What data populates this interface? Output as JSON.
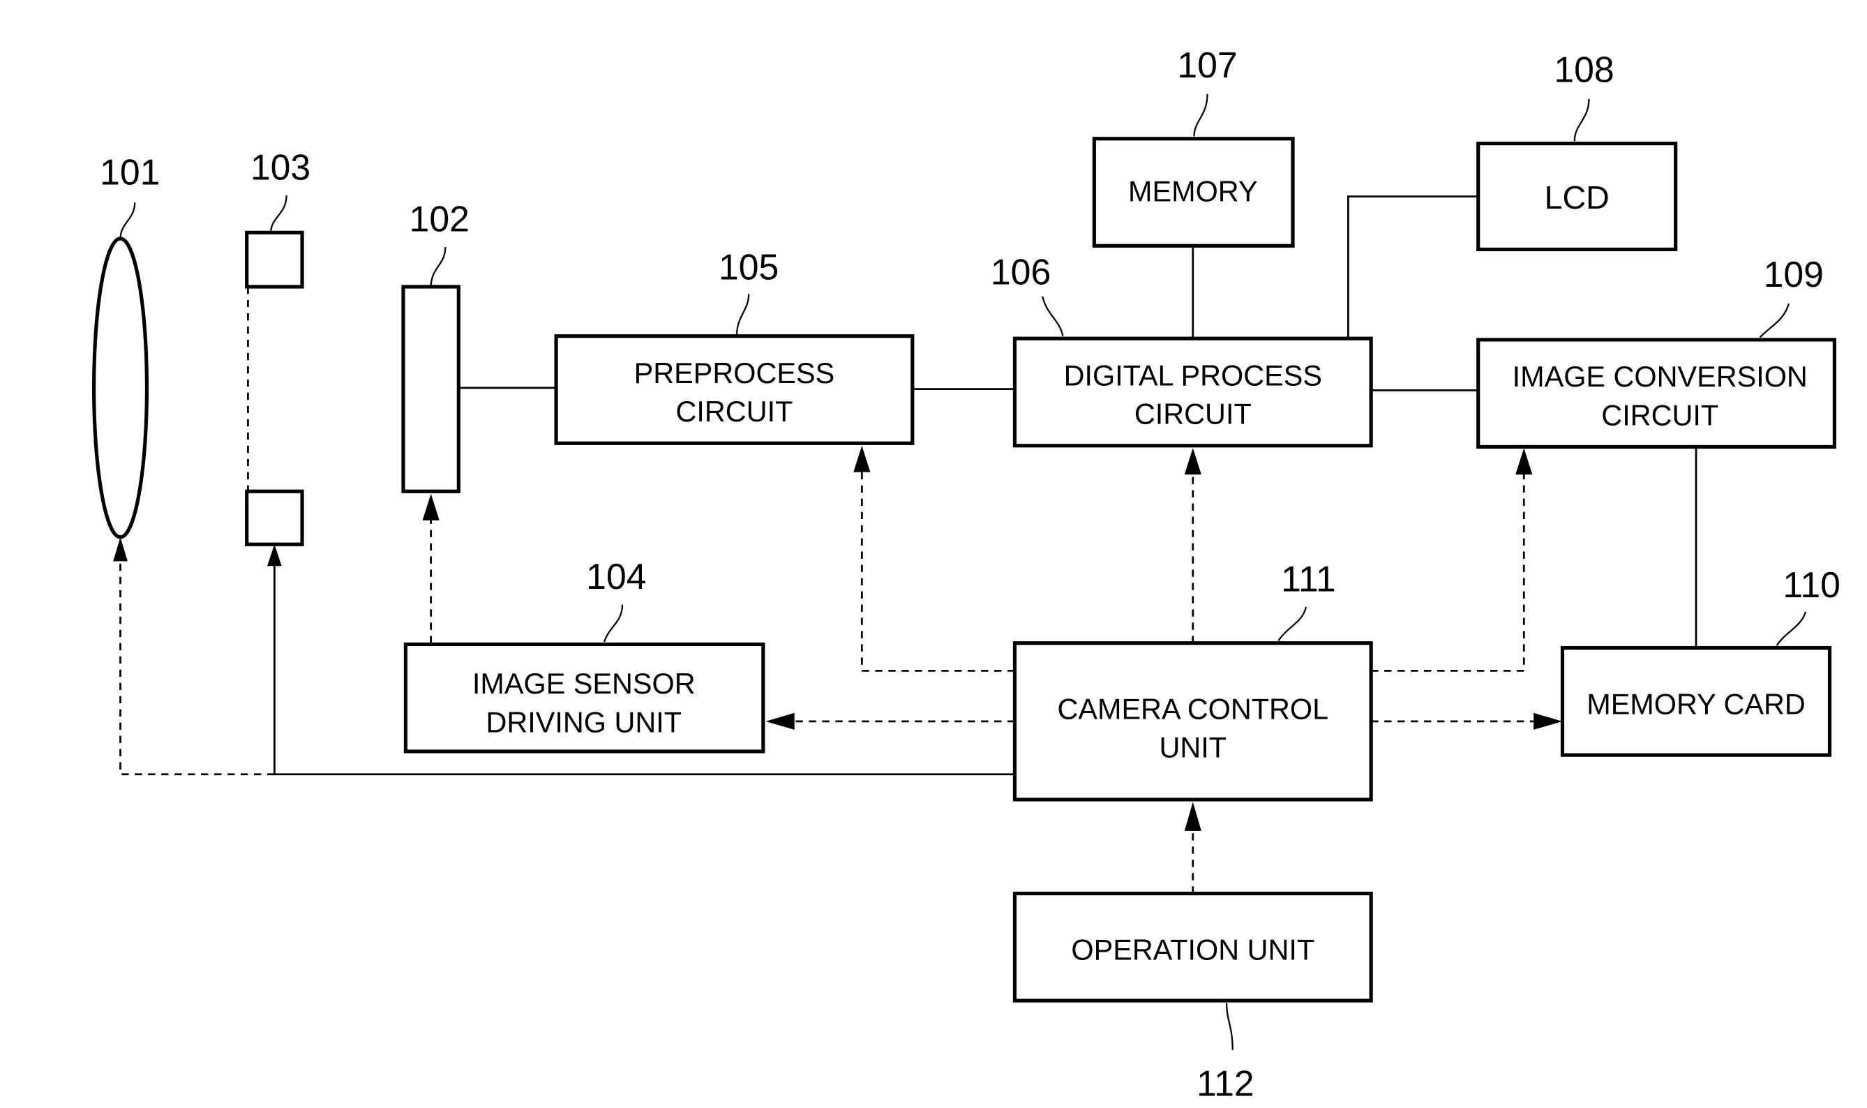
{
  "diagram": {
    "type": "block-diagram",
    "blocks": {
      "lens": {
        "ref": "101"
      },
      "aperture": {
        "ref": "103"
      },
      "image_sensor": {
        "ref": "102"
      },
      "preprocess": {
        "ref": "105",
        "line1": "PREPROCESS",
        "line2": "CIRCUIT"
      },
      "digital_process": {
        "ref": "106",
        "line1": "DIGITAL PROCESS",
        "line2": "CIRCUIT"
      },
      "memory": {
        "ref": "107",
        "line1": "MEMORY"
      },
      "lcd": {
        "ref": "108",
        "line1": "LCD"
      },
      "image_conversion": {
        "ref": "109",
        "line1": "IMAGE CONVERSION",
        "line2": "CIRCUIT"
      },
      "memory_card": {
        "ref": "110",
        "line1": "MEMORY CARD"
      },
      "camera_control": {
        "ref": "111",
        "line1": "CAMERA CONTROL",
        "line2": "UNIT"
      },
      "sensor_driving": {
        "ref": "104",
        "line1": "IMAGE SENSOR",
        "line2": "DRIVING UNIT"
      },
      "operation": {
        "ref": "112",
        "line1": "OPERATION UNIT"
      }
    },
    "connections": [
      {
        "from": "102",
        "to": "105",
        "style": "solid"
      },
      {
        "from": "105",
        "to": "106",
        "style": "solid"
      },
      {
        "from": "106",
        "to": "107",
        "style": "solid"
      },
      {
        "from": "106",
        "to": "108",
        "style": "solid"
      },
      {
        "from": "106",
        "to": "109",
        "style": "solid"
      },
      {
        "from": "109",
        "to": "110",
        "style": "solid"
      },
      {
        "from": "111",
        "to": "103",
        "style": "solid-arrow"
      },
      {
        "from": "111",
        "to": "101",
        "style": "dashed-arrow"
      },
      {
        "from": "104",
        "to": "102",
        "style": "dashed-arrow"
      },
      {
        "from": "111",
        "to": "104",
        "style": "dashed-arrow"
      },
      {
        "from": "111",
        "to": "105",
        "style": "dashed-arrow"
      },
      {
        "from": "111",
        "to": "106",
        "style": "dashed-arrow"
      },
      {
        "from": "111",
        "to": "109",
        "style": "dashed-arrow"
      },
      {
        "from": "111",
        "to": "110",
        "style": "dashed-arrow"
      },
      {
        "from": "112",
        "to": "111",
        "style": "dashed-arrow"
      }
    ]
  }
}
